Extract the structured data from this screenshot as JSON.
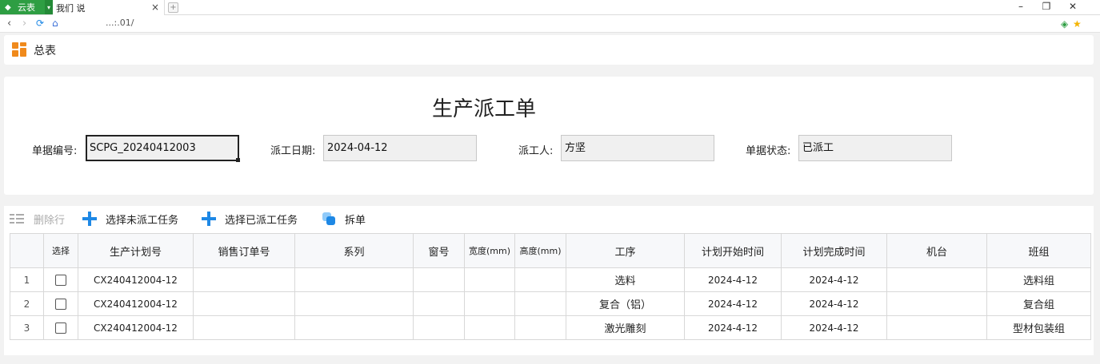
{
  "browser": {
    "app_badge": "云表",
    "tab_title": "我们    说",
    "tab_close": "×",
    "new_tab": "+",
    "address": "...:.01/",
    "win_min": "–",
    "win_restore": "❐",
    "win_close": "✕"
  },
  "header": {
    "title": "总表"
  },
  "form": {
    "title": "生产派工单",
    "fields": [
      {
        "label": "单据编号:",
        "value": "SCPG_20240412003"
      },
      {
        "label": "派工日期:",
        "value": "2024-04-12"
      },
      {
        "label": "派工人:",
        "value": "方坚"
      },
      {
        "label": "单据状态:",
        "value": "已派工"
      }
    ]
  },
  "toolbar": {
    "delete_row": "删除行",
    "select_unassigned": "选择未派工任务",
    "select_assigned": "选择已派工任务",
    "split": "拆单"
  },
  "table": {
    "columns": [
      "",
      "选择",
      "生产计划号",
      "销售订单号",
      "系列",
      "窗号",
      "宽度(mm)",
      "高度(mm)",
      "工序",
      "计划开始时间",
      "计划完成时间",
      "机台",
      "班组"
    ],
    "rows": [
      {
        "idx": "1",
        "plan_no": "CX240412004-12",
        "order_no": "",
        "series": "",
        "window_no": "",
        "width": "",
        "height": "",
        "process": "选料",
        "start": "2024-4-12",
        "end": "2024-4-12",
        "machine": "",
        "team": "选料组"
      },
      {
        "idx": "2",
        "plan_no": "CX240412004-12",
        "order_no": "",
        "series": "",
        "window_no": "",
        "width": "",
        "height": "",
        "process": "复合（铝）",
        "start": "2024-4-12",
        "end": "2024-4-12",
        "machine": "",
        "team": "复合组"
      },
      {
        "idx": "3",
        "plan_no": "CX240412004-12",
        "order_no": "",
        "series": "",
        "window_no": "",
        "width": "",
        "height": "",
        "process": "激光雕刻",
        "start": "2024-4-12",
        "end": "2024-4-12",
        "machine": "",
        "team": "型材包装组"
      }
    ]
  },
  "colors": {
    "accent": "#1e88e5",
    "brand_green": "#2e9e43",
    "header_icon": "#f08a1c"
  }
}
